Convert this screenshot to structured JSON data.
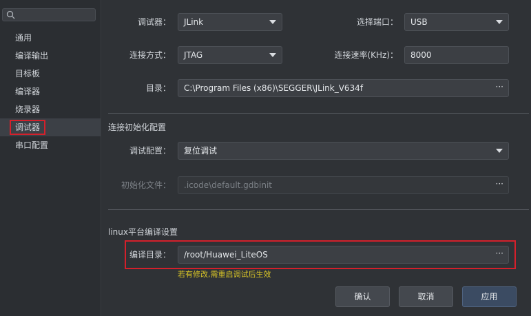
{
  "sidebar": {
    "search_placeholder": "",
    "items": [
      {
        "label": "通用"
      },
      {
        "label": "编译输出"
      },
      {
        "label": "目标板"
      },
      {
        "label": "编译器"
      },
      {
        "label": "烧录器"
      },
      {
        "label": "调试器",
        "selected": true
      },
      {
        "label": "串口配置"
      }
    ]
  },
  "debugger": {
    "debugger_label": "调试器：",
    "debugger_value": "JLink",
    "port_label": "选择端口：",
    "port_value": "USB",
    "connect_mode_label": "连接方式：",
    "connect_mode_value": "JTAG",
    "speed_label": "连接速率(KHz)：",
    "speed_value": "8000",
    "dir_label": "目录：",
    "dir_value": "C:\\Program Files (x86)\\SEGGER\\JLink_V634f"
  },
  "init_config": {
    "section_title": "连接初始化配置",
    "debug_config_label": "调试配置：",
    "debug_config_value": "复位调试",
    "init_file_label": "初始化文件：",
    "init_file_value": ".icode\\default.gdbinit"
  },
  "linux_build": {
    "section_title": "linux平台编译设置",
    "build_dir_label": "编译目录：",
    "build_dir_value": "/root/Huawei_LiteOS",
    "hint": "若有修改,需重启调试后生效"
  },
  "buttons": {
    "confirm": "确认",
    "cancel": "取消",
    "apply": "应用"
  },
  "ellipsis": "···",
  "colors": {
    "highlight_red": "#d4202b",
    "hint_yellow": "#d9c527"
  }
}
